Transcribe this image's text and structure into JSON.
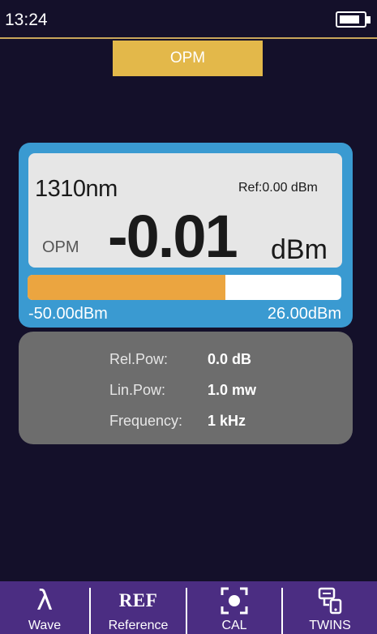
{
  "status_bar": {
    "time": "13:24",
    "battery_level": 0.85
  },
  "mode_tab": {
    "label": "OPM",
    "color": "#e3b84a"
  },
  "meter": {
    "wavelength": "1310nm",
    "reference": "Ref:0.00  dBm",
    "mode_label": "OPM",
    "power_value": "-0.01",
    "power_unit": "dBm",
    "bar_level": 0.63,
    "range_min": "-50.00dBm",
    "range_max": "26.00dBm"
  },
  "info": {
    "rows": [
      {
        "label": "Rel.Pow:",
        "value": "0.0 dB"
      },
      {
        "label": "Lin.Pow:",
        "value": "1.0 mw"
      },
      {
        "label": "Frequency:",
        "value": "1 kHz"
      }
    ]
  },
  "bottom_nav": [
    {
      "label": "Wave",
      "icon": "lambda-icon",
      "glyph": "λ"
    },
    {
      "label": "Reference",
      "icon": "ref-icon",
      "glyph": "REF"
    },
    {
      "label": "CAL",
      "icon": "calibration-target-icon"
    },
    {
      "label": "TWINS",
      "icon": "twins-devices-icon"
    }
  ],
  "colors": {
    "background": "#14102a",
    "meter_card": "#3a9ad1",
    "bar_fill": "#eba540",
    "info_card": "#6d6d6d",
    "bottom_bar": "#4b2d82",
    "accent_line": "#c8a65a"
  }
}
